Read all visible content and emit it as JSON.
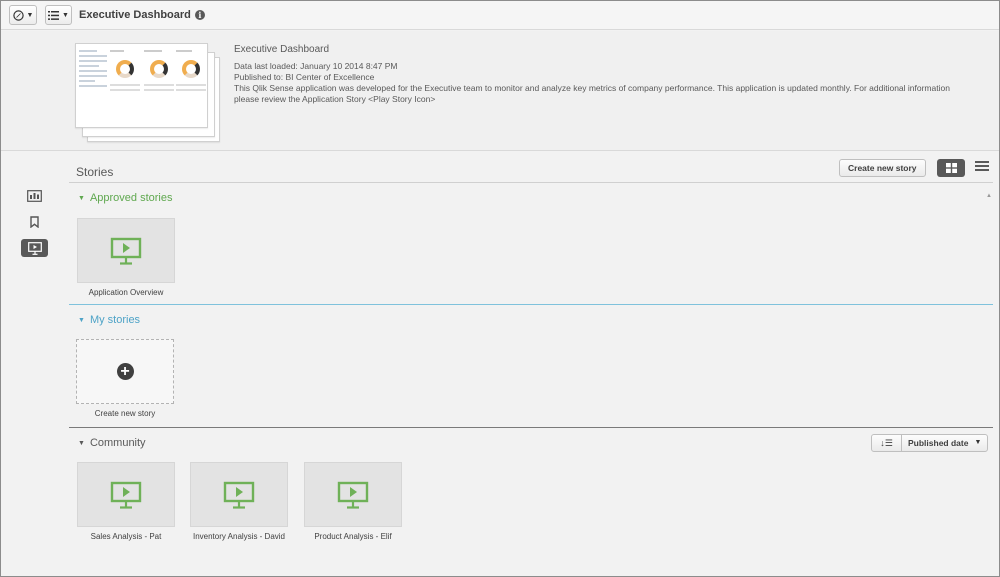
{
  "toolbar": {
    "nav_icon": "compass-icon",
    "menu_icon": "list-icon",
    "app_title": "Executive Dashboard",
    "info_icon": "info-icon",
    "info_glyph": "i"
  },
  "header": {
    "title": "Executive Dashboard",
    "last_loaded": "Data last loaded: January 10 2014 8:47 PM",
    "published_to": "Published to: BI Center of Excellence",
    "description": "This Qlik Sense application was developed for the Executive team to monitor and analyze key metrics of company performance.  This application is updated monthly.  For additional information please review the Application Story <Play Story Icon>"
  },
  "sidebar": {
    "items": [
      {
        "icon": "sheets-icon",
        "active": false
      },
      {
        "icon": "bookmark-icon",
        "active": false
      },
      {
        "icon": "stories-icon",
        "active": true
      }
    ]
  },
  "stories": {
    "title": "Stories",
    "create_button": "Create new story",
    "view_grid_icon": "grid-view-icon",
    "view_list_icon": "list-view-icon"
  },
  "approved": {
    "label": "Approved stories",
    "color": "#5fa84f",
    "items": [
      {
        "label": "Application Overview"
      }
    ]
  },
  "my_stories": {
    "label": "My stories",
    "color": "#4ea3c7",
    "create_label": "Create new story",
    "plus_glyph": "+"
  },
  "community": {
    "label": "Community",
    "color": "#595959",
    "sort_icon": "sort-desc-icon",
    "sort_glyph": "↓☰",
    "sort_label": "Published date",
    "items": [
      {
        "label": "Sales Analysis - Pat"
      },
      {
        "label": "Inventory Analysis - David"
      },
      {
        "label": "Product Analysis - Elif"
      }
    ]
  },
  "colors": {
    "story_icon_green": "#6fb158",
    "active_grey": "#595959"
  }
}
